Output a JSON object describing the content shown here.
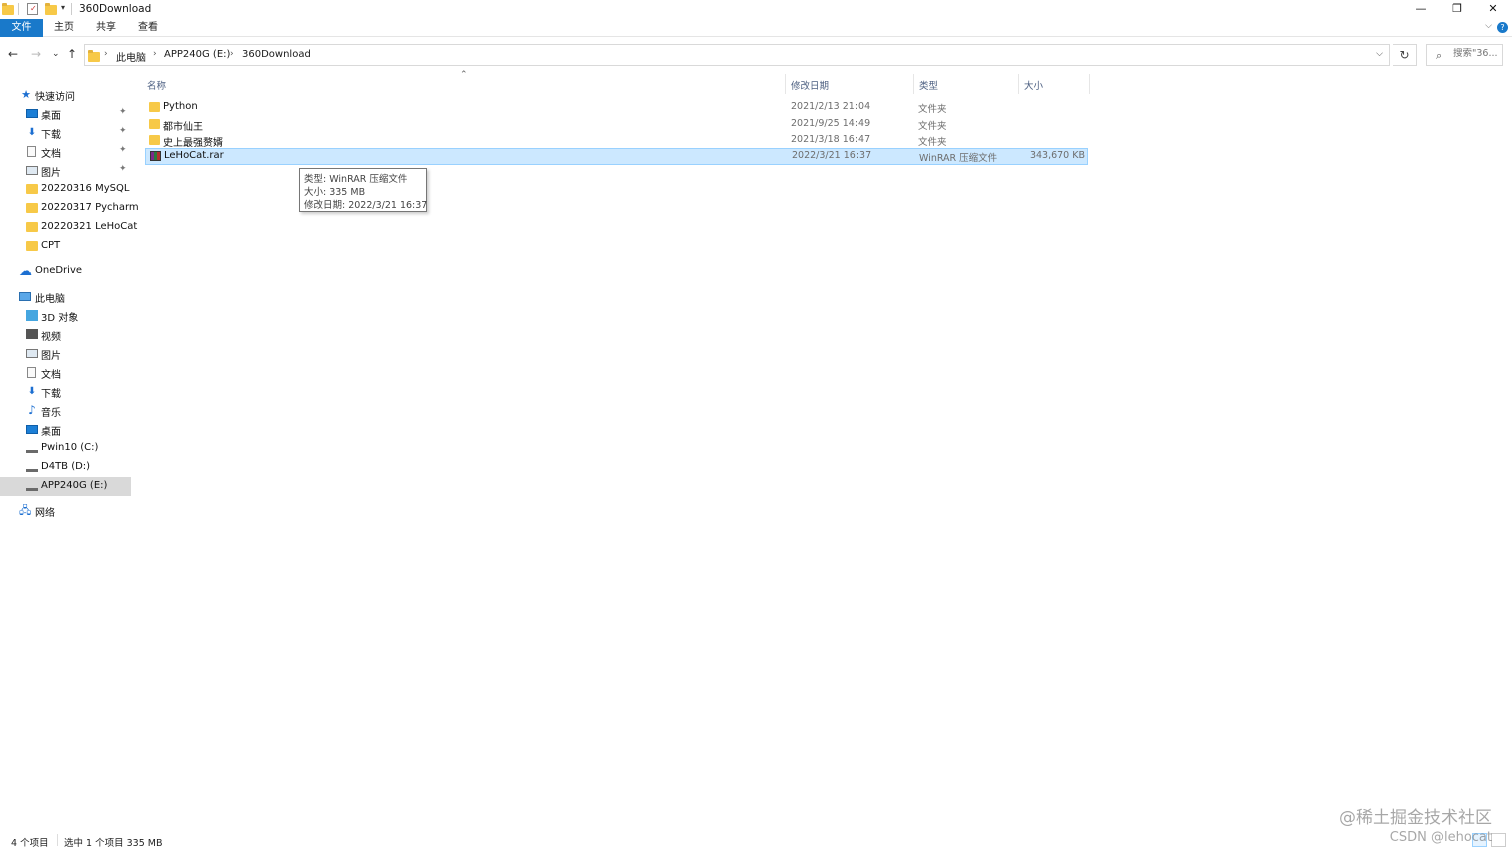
{
  "window": {
    "title": "360Download",
    "minimize_symbol": "—",
    "restore_symbol": "❐",
    "close_symbol": "✕"
  },
  "ribbon": {
    "tabs": [
      "文件",
      "主页",
      "共享",
      "查看"
    ],
    "active_tab": "文件",
    "help_symbol": "?",
    "collapse_symbol": "⌵"
  },
  "navigation": {
    "back_symbol": "←",
    "forward_symbol": "→",
    "recent_symbol": "⌄",
    "up_symbol": "↑",
    "breadcrumb": [
      "此电脑",
      "APP240G (E:)",
      "360Download"
    ],
    "breadcrumb_sep": "›",
    "dropdown_symbol": "⌵",
    "refresh_symbol": "↻",
    "search_placeholder": "搜索\"36...",
    "search_symbol": "⌕"
  },
  "sidebar": {
    "quick_access": {
      "label": "快速访问",
      "icon": "star-icon"
    },
    "quick_items": [
      {
        "label": "桌面",
        "icon": "desktop-icon",
        "pinned": true
      },
      {
        "label": "下载",
        "icon": "download-icon",
        "pinned": true
      },
      {
        "label": "文档",
        "icon": "document-icon",
        "pinned": true
      },
      {
        "label": "图片",
        "icon": "pictures-icon",
        "pinned": true
      },
      {
        "label": "20220316 MySQL",
        "icon": "folder-icon",
        "pinned": false
      },
      {
        "label": "20220317 Pycharm",
        "icon": "folder-icon",
        "pinned": false
      },
      {
        "label": "20220321 LeHoCat",
        "icon": "folder-icon",
        "pinned": false
      },
      {
        "label": "CPT",
        "icon": "folder-icon",
        "pinned": false
      }
    ],
    "onedrive": {
      "label": "OneDrive",
      "icon": "cloud-icon"
    },
    "this_pc": {
      "label": "此电脑",
      "icon": "computer-icon"
    },
    "pc_items": [
      {
        "label": "3D 对象",
        "icon": "3d-objects-icon"
      },
      {
        "label": "视频",
        "icon": "video-icon"
      },
      {
        "label": "图片",
        "icon": "pictures-icon"
      },
      {
        "label": "文档",
        "icon": "document-icon"
      },
      {
        "label": "下载",
        "icon": "download-icon"
      },
      {
        "label": "音乐",
        "icon": "music-icon"
      },
      {
        "label": "桌面",
        "icon": "desktop-icon"
      },
      {
        "label": "Pwin10 (C:)",
        "icon": "system-drive-icon"
      },
      {
        "label": "D4TB (D:)",
        "icon": "drive-icon"
      },
      {
        "label": "APP240G (E:)",
        "icon": "drive-icon",
        "selected": true
      }
    ],
    "network": {
      "label": "网络",
      "icon": "network-icon"
    },
    "pin_symbol": "📌",
    "expand_symbol": "›"
  },
  "file_list": {
    "columns": [
      "名称",
      "修改日期",
      "类型",
      "大小"
    ],
    "sort_symbol": "⌃",
    "rows": [
      {
        "name": "Python",
        "date": "2021/2/13 21:04",
        "type": "文件夹",
        "size": "",
        "kind": "folder"
      },
      {
        "name": "都市仙王",
        "date": "2021/9/25 14:49",
        "type": "文件夹",
        "size": "",
        "kind": "folder"
      },
      {
        "name": "史上最强赘婿",
        "date": "2021/3/18 16:47",
        "type": "文件夹",
        "size": "",
        "kind": "folder"
      },
      {
        "name": "LeHoCat.rar",
        "date": "2022/3/21 16:37",
        "type": "WinRAR 压缩文件",
        "size": "343,670 KB",
        "kind": "rar",
        "selected": true
      }
    ]
  },
  "tooltip": {
    "lines": [
      "类型: WinRAR 压缩文件",
      "大小: 335 MB",
      "修改日期: 2022/3/21 16:37"
    ]
  },
  "status": {
    "item_count": "4 个项目",
    "selection": "选中 1 个项目  335 MB"
  },
  "watermark": {
    "line1": "@稀土掘金技术社区",
    "line2": "CSDN @lehocat"
  },
  "colors": {
    "accent": "#1979ca",
    "selection_bg": "#cce8ff",
    "selection_border": "#99d1ff",
    "folder": "#f7c948"
  }
}
